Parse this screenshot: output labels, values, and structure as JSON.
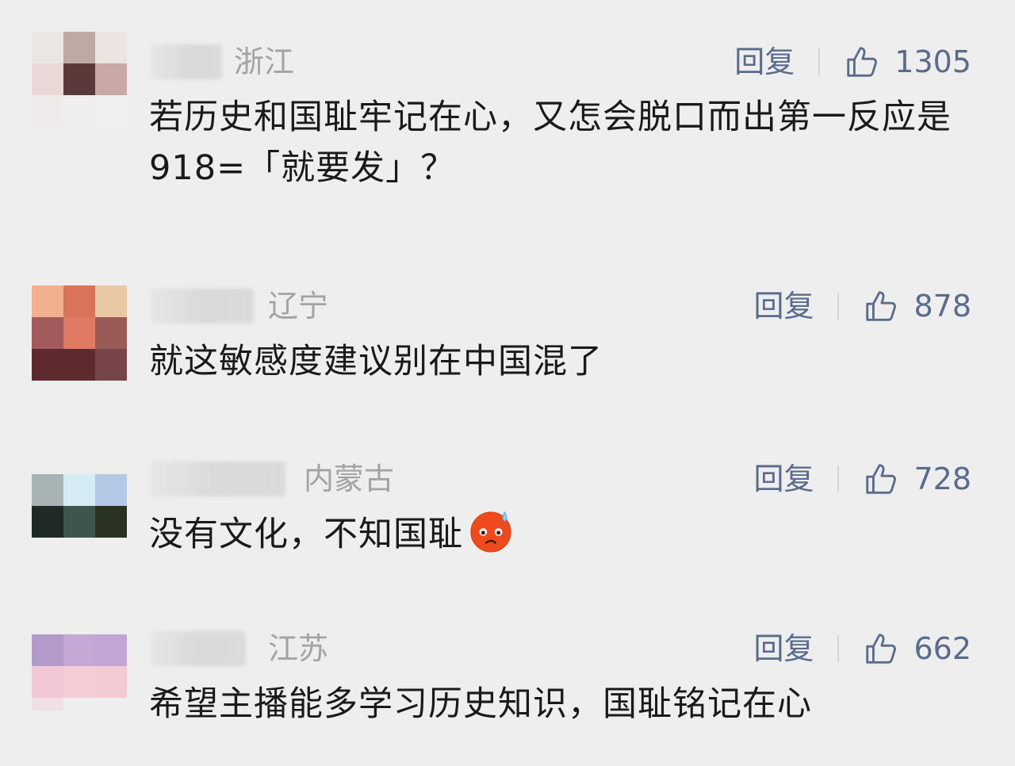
{
  "comments": [
    {
      "region": "浙江",
      "reply_label": "回复",
      "likes": "1305",
      "text": "若历史和国耻牢记在心，又怎会脱口而出第一反应是918=「就要发」？",
      "avatar_colors": [
        "#eae6e4",
        "#bfa9a5",
        "#ebe4e1",
        "#e9d9d6",
        "#5a3a38",
        "#c9a9a5",
        "#efeaea",
        "#efeded",
        "#efefef"
      ]
    },
    {
      "region": "辽宁",
      "reply_label": "回复",
      "likes": "878",
      "text": "就这敏感度建议别在中国混了",
      "avatar_colors": [
        "#f1b08e",
        "#d9735a",
        "#e9c8a4",
        "#a25a5d",
        "#e07a65",
        "#9a5a55",
        "#5e2a2e",
        "#5e2a2e",
        "#77454a"
      ]
    },
    {
      "region": "内蒙古",
      "reply_label": "回复",
      "likes": "728",
      "text": "没有文化，不知国耻",
      "emoji_icon": "anxious-sweat-face-emoji",
      "avatar_colors": [
        "#a7b3b4",
        "#d6ecf5",
        "#b5c9e6",
        "#1f2a26",
        "#3d554c",
        "#2a3322",
        "#ececec",
        "#ececec",
        "#ececec"
      ]
    },
    {
      "region": "江苏",
      "reply_label": "回复",
      "likes": "662",
      "text": "希望主播能多学习历史知识，国耻铭记在心",
      "avatar_colors": [
        "#b39bc9",
        "#c5a8d6",
        "#c2a4d5",
        "#f2c8d4",
        "#f5cdd6",
        "#f4cad3",
        "#efe0e4",
        "#eeeeee",
        "#eeeeee"
      ]
    }
  ],
  "colors": {
    "background": "#eeeeee",
    "action_text": "#5b6b8c",
    "region_text": "#a3a3a3",
    "body_text": "#1a1a1a"
  }
}
